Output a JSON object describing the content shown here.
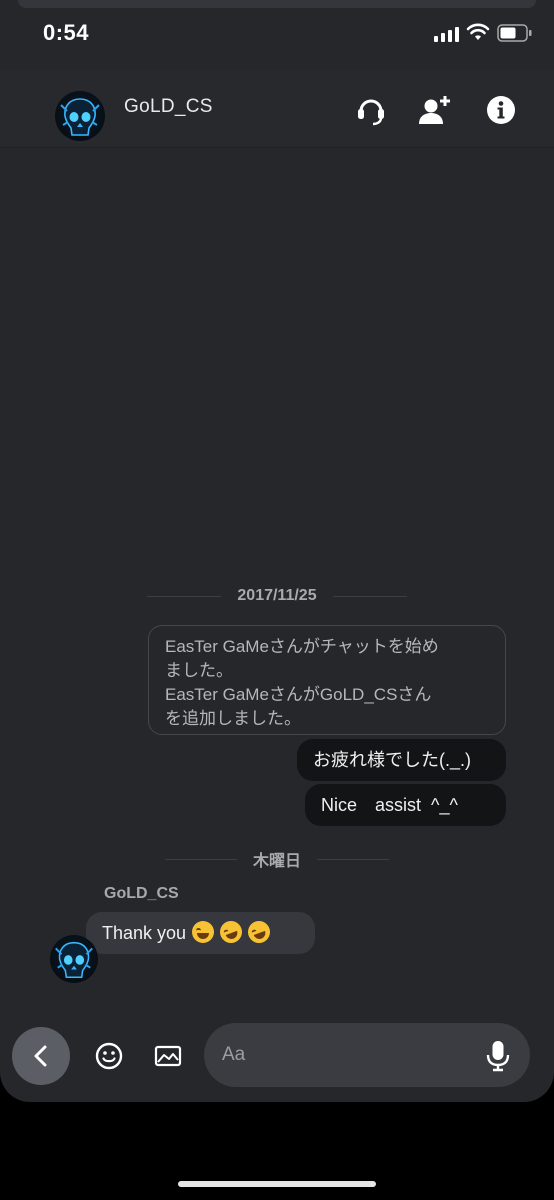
{
  "status": {
    "time": "0:54"
  },
  "header": {
    "title": "GoLD_CS",
    "icons": [
      "headset-icon",
      "add-person-icon",
      "info-icon"
    ]
  },
  "messages": {
    "date_1": "2017/11/25",
    "system_lines": [
      "EasTer GaMeさんがチャットを始め",
      "ました。",
      "EasTer GaMeさんがGoLD_CSさん",
      "を追加しました。"
    ],
    "outgoing": [
      "お疲れ様でした(._.)",
      "Nice　assist  ^_^"
    ],
    "date_2": "木曜日",
    "incoming_sender": "GoLD_CS",
    "incoming_text": "Thank you",
    "incoming_emojis": [
      "joy-emoji",
      "rofl-emoji",
      "rofl-emoji"
    ]
  },
  "composer": {
    "placeholder": "Aa",
    "icons": [
      "back-icon",
      "emoji-icon",
      "image-icon",
      "mic-icon"
    ]
  },
  "colors": {
    "background": "#25272b",
    "bubble_out": "#131416",
    "bubble_in": "#36383d",
    "input": "#3a3c41"
  }
}
